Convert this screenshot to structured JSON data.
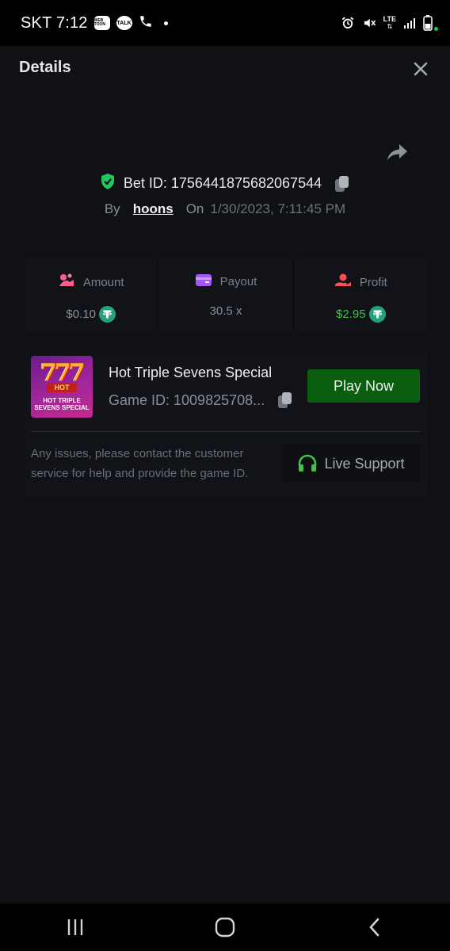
{
  "status_bar": {
    "carrier_time": "SKT 7:12",
    "badge_1": "WEB TOON",
    "badge_2": "TALK",
    "network": "LTE"
  },
  "header": {
    "title": "Details"
  },
  "bet": {
    "id_text": "Bet ID: 1756441875682067544",
    "by_label": "By",
    "user": "hoons",
    "on_label": "On",
    "date": "1/30/2023, 7:11:45 PM"
  },
  "stats": [
    {
      "label": "Amount",
      "value": "$0.10",
      "icon": "coins-icon",
      "color": "#ff5d8f"
    },
    {
      "label": "Payout",
      "value": "30.5 x",
      "icon": "wallet-icon",
      "color": "#a855f7"
    },
    {
      "label": "Profit",
      "value": "$2.95",
      "icon": "hand-coin-icon",
      "color": "#ff4d5a"
    }
  ],
  "game": {
    "name": "Hot Triple Sevens Special",
    "id_text": "Game ID: 1009825708...",
    "thumb_hot": "HOT",
    "thumb_caption_1": "HOT TRIPLE",
    "thumb_caption_2": "SEVENS SPECIAL",
    "play_label": "Play Now"
  },
  "support": {
    "notice": "Any issues, please contact the customer service for help and provide the game ID.",
    "button_label": "Live Support"
  },
  "colors": {
    "accent_green": "#0b5d0f",
    "profit_green": "#3fc14a",
    "tether": "#26a17b",
    "shield_green": "#22c55e"
  }
}
